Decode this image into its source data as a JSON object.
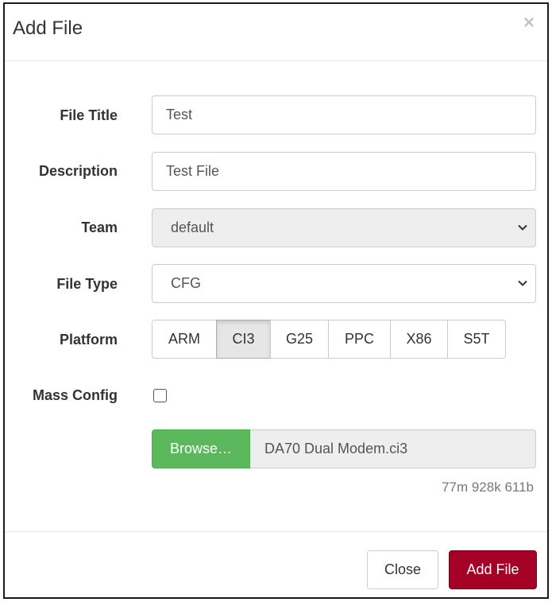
{
  "modal": {
    "title": "Add File",
    "close_glyph": "×"
  },
  "form": {
    "file_title": {
      "label": "File Title",
      "value": "Test"
    },
    "description": {
      "label": "Description",
      "value": "Test File"
    },
    "team": {
      "label": "Team",
      "value": "default",
      "disabled": true
    },
    "file_type": {
      "label": "File Type",
      "value": "CFG"
    },
    "platform": {
      "label": "Platform",
      "options": [
        "ARM",
        "CI3",
        "G25",
        "PPC",
        "X86",
        "S5T"
      ],
      "selected": "CI3"
    },
    "mass_config": {
      "label": "Mass Config",
      "checked": false
    },
    "file": {
      "browse_label": "Browse…",
      "name": "DA70 Dual Modem.ci3",
      "size": "77m 928k 611b"
    }
  },
  "footer": {
    "close_label": "Close",
    "add_label": "Add File"
  },
  "colors": {
    "browse": "#5cb85c",
    "primary": "#a50026"
  },
  "icons": {
    "select_arrow": "chevron-down-icon",
    "dismiss": "close-icon"
  }
}
